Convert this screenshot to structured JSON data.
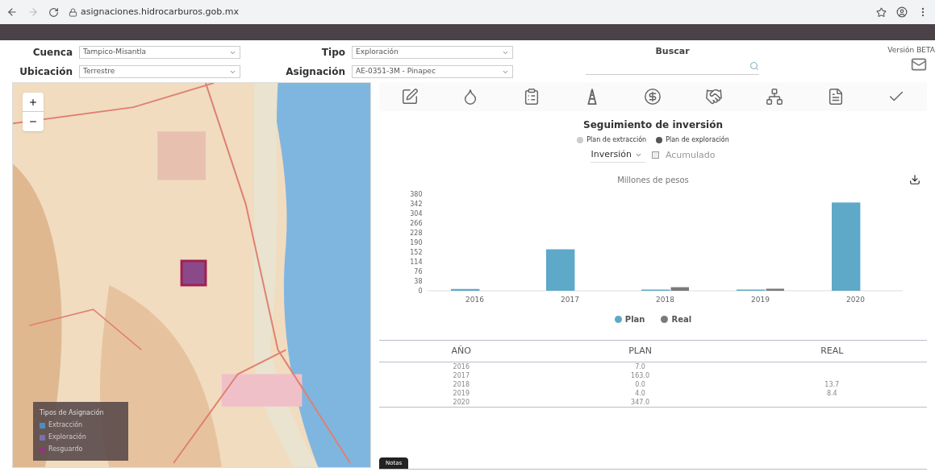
{
  "browser": {
    "url": "asignaciones.hidrocarburos.gob.mx"
  },
  "filters": [
    {
      "label": "Cuenca",
      "value": "Tampico-Misantla"
    },
    {
      "label": "Tipo",
      "value": "Exploración"
    },
    {
      "label": "Ubicación",
      "value": "Terrestre"
    },
    {
      "label": "Asignación",
      "value": "AE-0351-3M - Pinapec"
    }
  ],
  "search": {
    "label": "Buscar"
  },
  "version": "Versión BETA",
  "map": {
    "legend": {
      "title": "Tipos de Asignación",
      "items": [
        {
          "label": "Extracción",
          "color": "#4a8fc0"
        },
        {
          "label": "Exploración",
          "color": "#7a6fb0"
        },
        {
          "label": "Resguardo",
          "color": "#8a3a7a"
        }
      ]
    }
  },
  "toolbar": [
    {
      "kind": "edit"
    },
    {
      "kind": "drop"
    },
    {
      "kind": "list"
    },
    {
      "kind": "derrick"
    },
    {
      "kind": "dollar"
    },
    {
      "kind": "handshake"
    },
    {
      "kind": "network"
    },
    {
      "kind": "file"
    },
    {
      "kind": "check"
    }
  ],
  "panel": {
    "title": "Seguimiento de inversión",
    "plans": [
      {
        "label": "Plan de extracción",
        "selected": false
      },
      {
        "label": "Plan de exploración",
        "selected": true
      }
    ],
    "measure": "Inversión",
    "cumulative": {
      "label": "Acumulado",
      "checked": false
    },
    "chart_data": {
      "type": "bar",
      "title": "Millones de pesos",
      "categories": [
        "2016",
        "2017",
        "2018",
        "2019",
        "2020"
      ],
      "series": [
        {
          "name": "Plan",
          "color": "#5ea8c8",
          "values": [
            7,
            163,
            0,
            4,
            347
          ]
        },
        {
          "name": "Real",
          "color": "#7a7a7a",
          "values": [
            null,
            null,
            14,
            8,
            null
          ]
        }
      ],
      "legend": "bottom",
      "ylim": [
        0,
        380
      ],
      "yticks": [
        0,
        38,
        76,
        114,
        152,
        190,
        228,
        266,
        304,
        342,
        380
      ]
    },
    "table": {
      "columns": [
        "AÑO",
        "PLAN",
        "REAL"
      ],
      "rows": [
        [
          "2016",
          "7.0",
          ""
        ],
        [
          "2017",
          "163.0",
          ""
        ],
        [
          "2018",
          "0.0",
          "13.7"
        ],
        [
          "2019",
          "4.0",
          "8.4"
        ],
        [
          "2020",
          "347.0",
          ""
        ]
      ]
    },
    "tab": "Notas"
  }
}
